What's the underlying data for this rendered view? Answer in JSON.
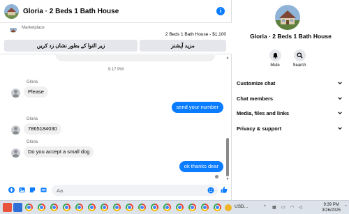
{
  "chat": {
    "title": "Gloria · 2 Beds 1 Bath House",
    "marketplace_label": "Marketplace",
    "listing_text": "2 Beds 1 Bath House - $1,100",
    "btn_mark_pending": "زیر التوا کے بطور نشان زد کریں",
    "btn_more_options": "مزید آپشنز",
    "timestamp": "9:17 PM",
    "messages": [
      {
        "sender": "Gloria",
        "text": "Please",
        "direction": "in"
      },
      {
        "text": "send your number",
        "direction": "out"
      },
      {
        "sender": "Gloria",
        "text": "7865184030",
        "direction": "in"
      },
      {
        "sender": "Gloria",
        "text": "Do you accept a small dog",
        "direction": "in"
      },
      {
        "text": "ok thanks dear",
        "direction": "out"
      }
    ],
    "composer_placeholder": "Aa"
  },
  "panel": {
    "name": "Gloria · 2 Beds 1 Bath House",
    "actions": [
      {
        "label": "Mute",
        "icon": "bell-icon"
      },
      {
        "label": "Search",
        "icon": "search-icon"
      }
    ],
    "sections": [
      {
        "label": "Customize chat"
      },
      {
        "label": "Chat members"
      },
      {
        "label": "Media, files and links"
      },
      {
        "label": "Privacy & support"
      }
    ]
  },
  "taskbar": {
    "currency": "USD...",
    "time": "9:39 PM",
    "date": "3/26/2025"
  },
  "colors": {
    "accent": "#0a7cff",
    "bubble_in": "#f0f0f0",
    "button_bg": "#e4e6eb"
  }
}
